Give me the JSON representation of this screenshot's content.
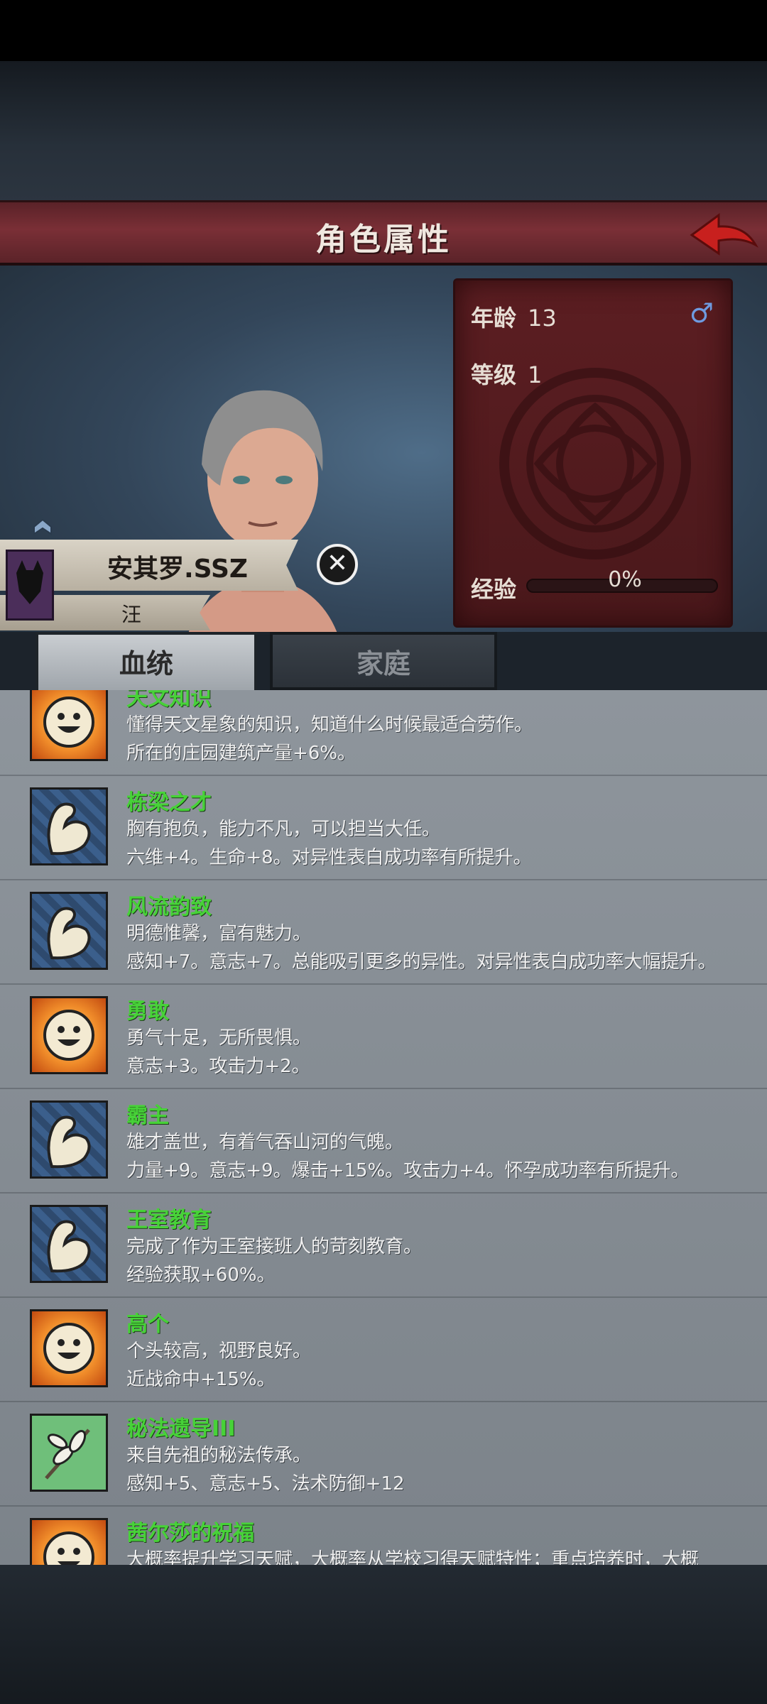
{
  "header": {
    "title": "角色属性"
  },
  "character": {
    "name": "安其罗.SSZ",
    "family": "汪",
    "age_label": "年龄",
    "age": "13",
    "level_label": "等级",
    "level": "1",
    "gender_symbol": "♂",
    "exp_label": "经验",
    "exp_value": "0%",
    "exp_fraction": 0
  },
  "tabs": [
    {
      "label": "血统",
      "active": true
    },
    {
      "label": "家庭",
      "active": false
    }
  ],
  "traits": [
    {
      "icon": "smile-icon",
      "name": "天文知识",
      "desc": "懂得天文星象的知识，知道什么时候最适合劳作。",
      "effect": "所在的庄园建筑产量+6%。"
    },
    {
      "icon": "flexed-arm-icon",
      "name": "栋梁之才",
      "desc": "胸有抱负，能力不凡，可以担当大任。",
      "effect": "六维+4。生命+8。对异性表白成功率有所提升。"
    },
    {
      "icon": "flexed-arm-icon",
      "name": "风流韵致",
      "desc": "明德惟馨，富有魅力。",
      "effect": "感知+7。意志+7。总能吸引更多的异性。对异性表白成功率大幅提升。"
    },
    {
      "icon": "smile-icon",
      "name": "勇敢",
      "desc": "勇气十足，无所畏惧。",
      "effect": "意志+3。攻击力+2。"
    },
    {
      "icon": "flexed-arm-icon",
      "name": "霸主",
      "desc": "雄才盖世，有着气吞山河的气魄。",
      "effect": "力量+9。意志+9。爆击+15%。攻击力+4。怀孕成功率有所提升。"
    },
    {
      "icon": "flexed-arm-icon",
      "name": "王室教育",
      "desc": "完成了作为王室接班人的苛刻教育。",
      "effect": "经验获取+60%。"
    },
    {
      "icon": "smile-icon",
      "name": "高个",
      "desc": "个头较高，视野良好。",
      "effect": "近战命中+15%。"
    },
    {
      "icon": "leaf-branch-icon",
      "name": "秘法遗导III",
      "desc": "来自先祖的秘法传承。",
      "effect": "感知+5、意志+5、法术防御+12"
    },
    {
      "icon": "smile-icon",
      "name": "茜尔莎的祝福",
      "desc": "大概率提升学习天赋，大概率从学校习得天赋特性；重点培养时，大概",
      "effect": ""
    }
  ],
  "colors": {
    "title_bar": "#7a2f36",
    "trait_name": "#47d238",
    "stats_panel": "#5c1e22",
    "gender": "#6e9be0"
  }
}
